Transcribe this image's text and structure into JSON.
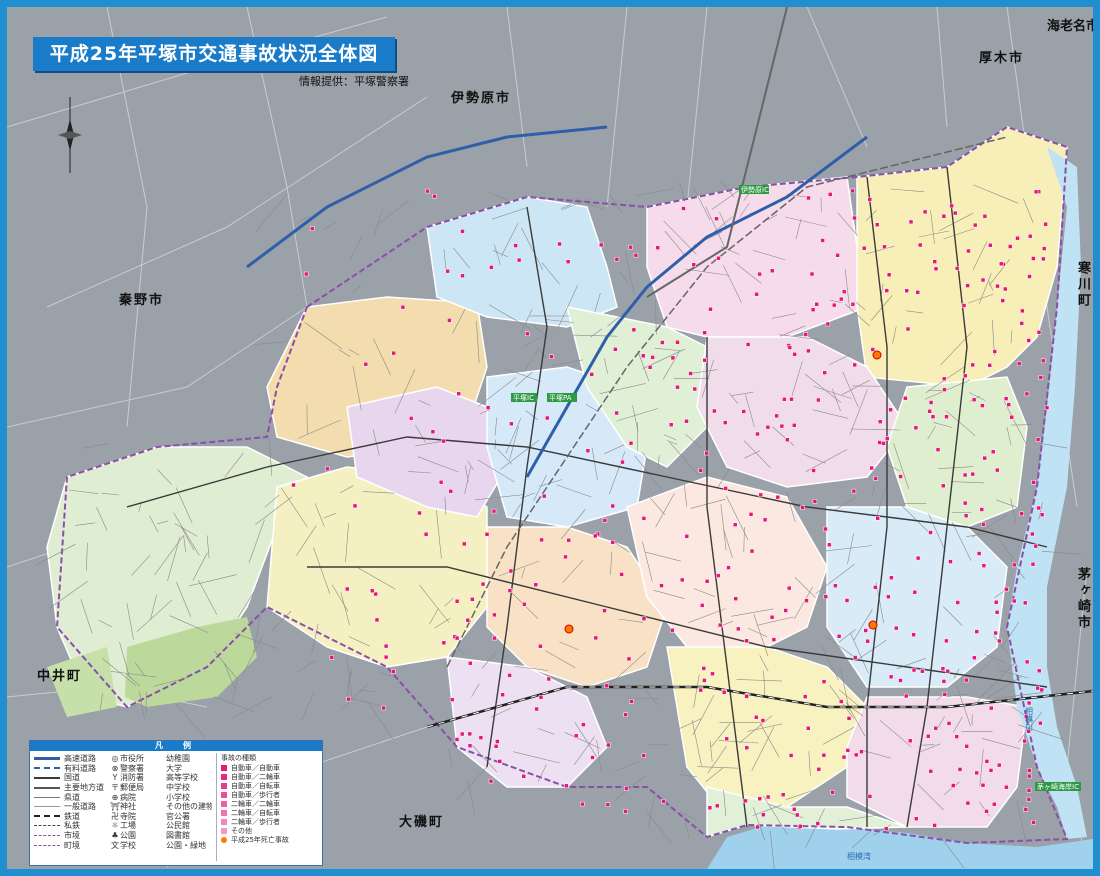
{
  "title": "平成25年平塚市交通事故状況全体図",
  "source": "情報提供：平塚警察署",
  "colors": {
    "frame": "#1f8fd0",
    "surrounding": "#9aa1a8",
    "sea": "#9fd0ec",
    "river": "#bfe2f5",
    "accident_marker": "#e6177a",
    "fatal_marker": "#ff7a00",
    "expressway": "#2f5fa8",
    "railway": "#444444"
  },
  "cities": {
    "isehara": "伊勢原市",
    "atsugi": "厚木市",
    "ebina": "海老名市",
    "hadano": "秦野市",
    "samukawa": "寒川町",
    "chigasaki": "茅ヶ崎市",
    "nakai": "中井町",
    "oiso": "大磯町"
  },
  "places": {
    "sagami_river": "相模川",
    "sagami_bay": "相模湾",
    "hiratsuka_ic": "平塚IC",
    "hiratsuka_pa": "平塚PA",
    "isehara_ic": "伊勢原IC",
    "chigasaki_ic": "茅ヶ崎海岸IC"
  },
  "legend": {
    "heading": "凡　例",
    "lines": [
      "高速道路",
      "有料道路",
      "国道",
      "主要地方道",
      "県道",
      "一般道路",
      "鉄道",
      "私鉄",
      "市境",
      "町境"
    ],
    "symbols": [
      "市役所",
      "警察署",
      "消防署",
      "郵便局",
      "病院",
      "神社",
      "寺院",
      "工場",
      "公園",
      "学校"
    ],
    "symbol_glyphs": [
      "◎",
      "⊗",
      "Y",
      "〒",
      "⊕",
      "⛩",
      "卍",
      "☼",
      "♣",
      "文"
    ],
    "symbols2": [
      "幼稚園",
      "大学",
      "高等学校",
      "中学校",
      "小学校",
      "その他の建物",
      "官公署",
      "公民館",
      "図書館",
      "公園・緑地"
    ],
    "accident_heading": "事故の種類",
    "accident_types": [
      "自動車／自動車",
      "自動車／二輪車",
      "自動車／自転車",
      "自動車／歩行者",
      "二輪車／二輪車",
      "二輪車／自転車",
      "二輪車／歩行者",
      "その他"
    ],
    "fatal": "平成25年死亡事故"
  }
}
